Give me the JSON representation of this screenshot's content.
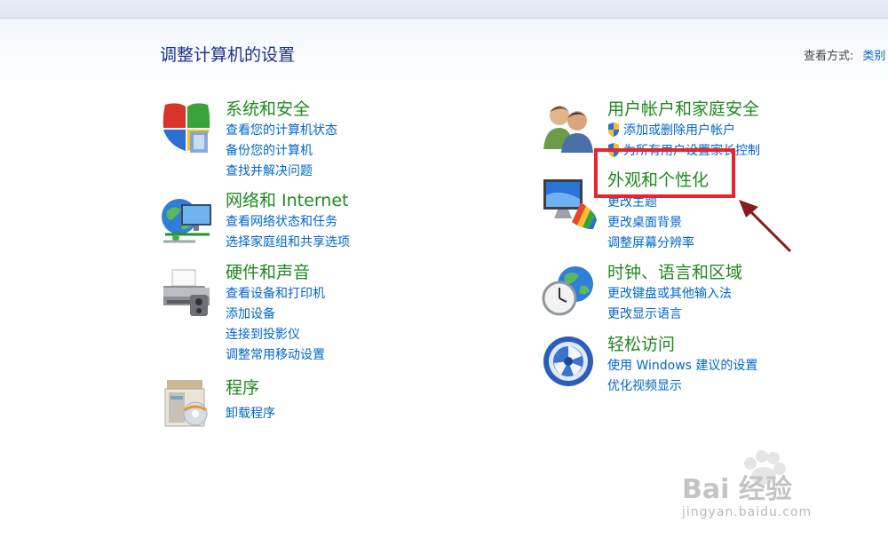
{
  "page_title": "调整计算机的设置",
  "view_by": {
    "label": "查看方式:",
    "value": "类别"
  },
  "categories": [
    {
      "title": "系统和安全",
      "links": [
        "查看您的计算机状态",
        "备份您的计算机",
        "查找并解决问题"
      ],
      "icon": "shield-icon"
    },
    {
      "title": "网络和 Internet",
      "links": [
        "查看网络状态和任务",
        "选择家庭组和共享选项"
      ],
      "icon": "network-globe-icon"
    },
    {
      "title": "硬件和声音",
      "links": [
        "查看设备和打印机",
        "添加设备",
        "连接到投影仪",
        "调整常用移动设置"
      ],
      "icon": "printer-icon"
    },
    {
      "title": "程序",
      "links": [
        "卸载程序"
      ],
      "icon": "programs-box-icon"
    },
    {
      "title": "用户帐户和家庭安全",
      "links": [
        "添加或删除用户帐户",
        "为所有用户设置家长控制"
      ],
      "icon": "users-icon"
    },
    {
      "title": "外观和个性化",
      "links": [
        "更改主题",
        "更改桌面背景",
        "调整屏幕分辨率"
      ],
      "icon": "monitor-palette-icon"
    },
    {
      "title": "时钟、语言和区域",
      "links": [
        "更改键盘或其他输入法",
        "更改显示语言"
      ],
      "icon": "clock-globe-icon"
    },
    {
      "title": "轻松访问",
      "links": [
        "使用 Windows 建议的设置",
        "优化视频显示"
      ],
      "icon": "ease-of-access-icon"
    }
  ],
  "watermark": {
    "brand": "Bai 经验",
    "url": "jingyan.baidu.com"
  },
  "colors": {
    "title_green": "#1f8a1f",
    "link_blue": "#0066cc",
    "heading_blue": "#1e3287",
    "highlight_red": "#e8252e"
  }
}
